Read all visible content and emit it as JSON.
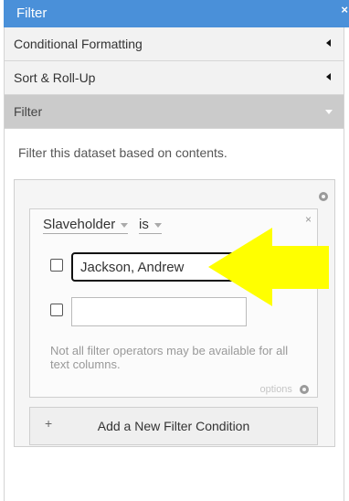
{
  "window": {
    "title": "Filter",
    "close_label": "×"
  },
  "sections": [
    {
      "label": "Conditional Formatting"
    },
    {
      "label": "Sort & Roll-Up"
    },
    {
      "label": "Filter"
    }
  ],
  "filter": {
    "description": "Filter this dataset based on contents.",
    "condition": {
      "column": "Slaveholder",
      "operator": "is",
      "remove_label": "×",
      "values": [
        {
          "text": "Jackson, Andrew",
          "checked": false
        },
        {
          "text": "",
          "checked": false
        }
      ],
      "note": "Not all filter operators may be available for all text columns.",
      "options_label": "options"
    },
    "add_condition": {
      "plus": "+",
      "label": "Add a New Filter Condition"
    }
  },
  "colors": {
    "titlebar": "#4a90d9",
    "arrow": "#ffff00",
    "section_bg": "#f2f2f2",
    "active_section_bg": "#cbcbcb"
  }
}
